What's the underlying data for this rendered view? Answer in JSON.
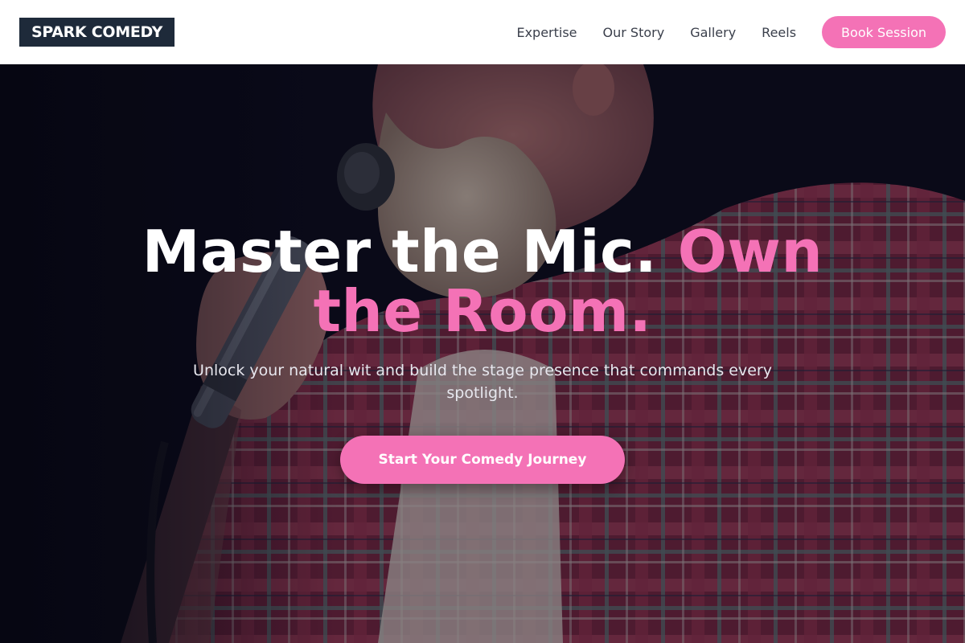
{
  "header": {
    "logo": "SPARK COMEDY",
    "nav": [
      "Expertise",
      "Our Story",
      "Gallery",
      "Reels"
    ],
    "book_label": "Book Session"
  },
  "hero": {
    "title_main": "Master the Mic. ",
    "title_accent": "Own the Room.",
    "subtitle": "Unlock your natural wit and build the stage presence that commands every spotlight.",
    "cta_label": "Start Your Comedy Journey"
  },
  "colors": {
    "accent": "#f472b6",
    "logo_bg": "#1e2a3a",
    "header_bg": "#ffffff"
  }
}
